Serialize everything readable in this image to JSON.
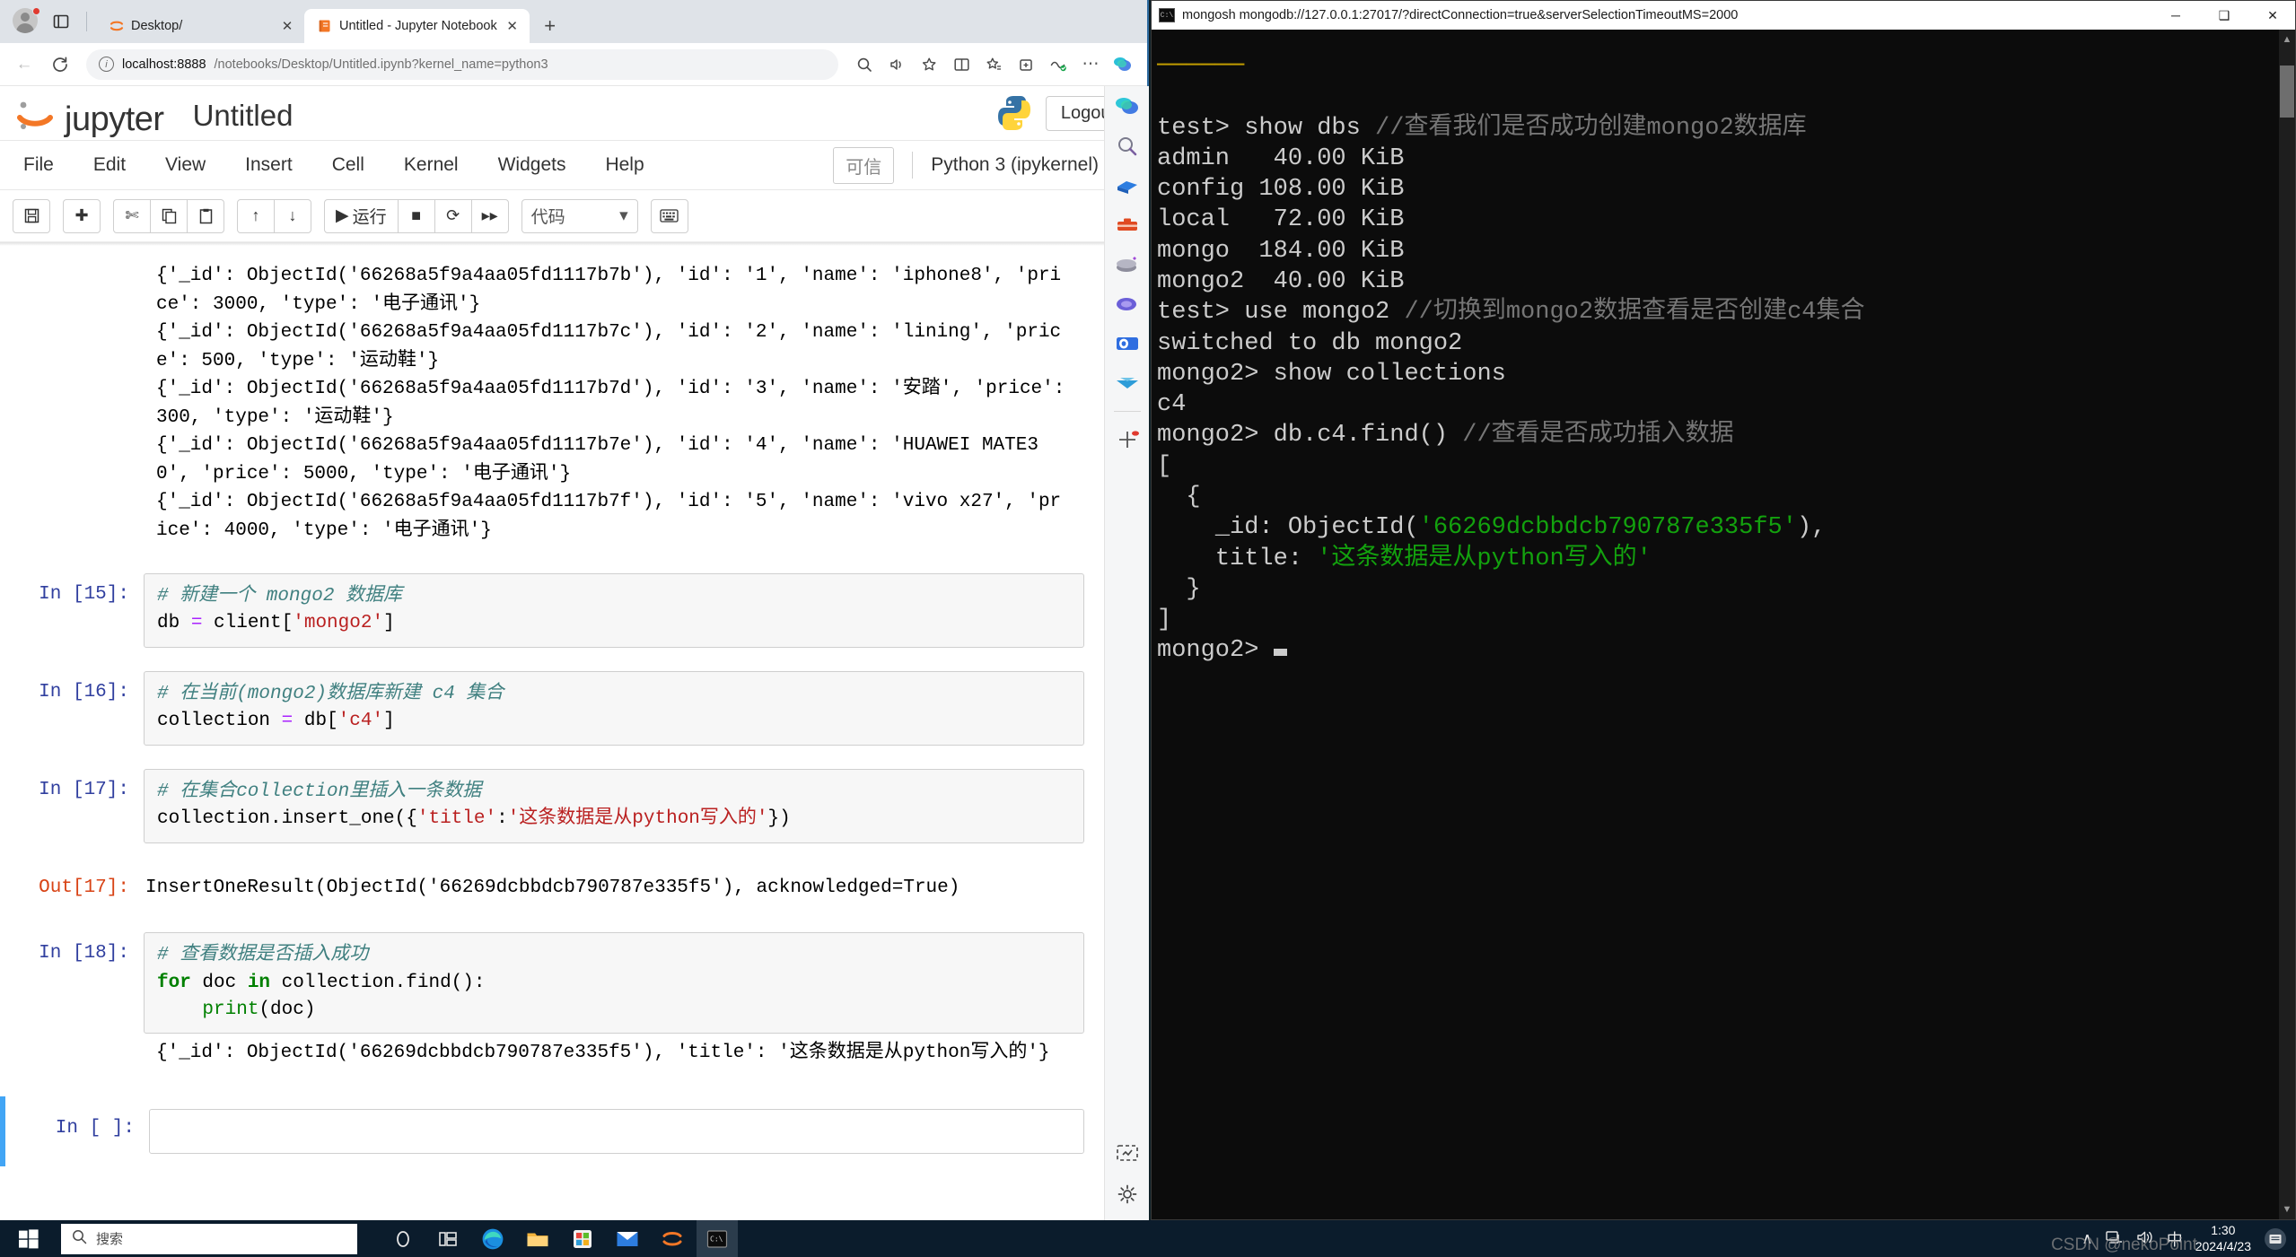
{
  "browser": {
    "tabs": [
      {
        "title": "Desktop/",
        "favicon": "jupyter-icon",
        "active": false
      },
      {
        "title": "Untitled - Jupyter Notebook",
        "favicon": "notebook-icon",
        "active": true
      }
    ],
    "newtab_label": "+",
    "address": {
      "host": "localhost:8888",
      "path": "/notebooks/Desktop/Untitled.ipynb?kernel_name=python3",
      "full": "localhost:8888/notebooks/Desktop/Untitled.ipynb?kernel_name=python3"
    },
    "nav": {
      "back": "←",
      "reload": "⟳"
    },
    "toolbar_icons": [
      "split-screen-icon",
      "favorites-icon",
      "collections-icon",
      "browser-essentials-icon",
      "settings-more-icon",
      "copilot-icon"
    ],
    "window_controls": {
      "minimize": "─",
      "maximize": "□",
      "close": "✕"
    }
  },
  "edge_sidebar": {
    "items": [
      "copilot-icon",
      "search-icon",
      "shopping-icon",
      "tools-icon",
      "games-icon",
      "office-icon",
      "outlook-icon",
      "drop-icon",
      "add-app-icon"
    ],
    "bottom": [
      "screenshot-icon",
      "sidebar-settings-icon"
    ]
  },
  "jupyter": {
    "logo_text": "jupyter",
    "notebook_title": "Untitled",
    "logout_label": "Logout",
    "trust_label": "可信",
    "kernel_label": "Python 3 (ipykernel)",
    "menus": [
      "File",
      "Edit",
      "View",
      "Insert",
      "Cell",
      "Kernel",
      "Widgets",
      "Help"
    ],
    "toolbar": {
      "save": "save-icon",
      "add": "add-cell-icon",
      "cut": "cut-icon",
      "copy": "copy-icon",
      "paste": "paste-icon",
      "move_up": "move-up-icon",
      "move_down": "move-down-icon",
      "run_label": "运行",
      "run_icon": "play-icon",
      "stop": "stop-icon",
      "restart": "restart-icon",
      "restart_run_all": "fast-forward-icon",
      "cell_type_value": "代码",
      "command_palette": "keyboard-icon"
    },
    "cells": [
      {
        "kind": "stream-output-top",
        "text": "{'_id': ObjectId('66268a5f9a4aa05fd1117b7b'), 'id': '1', 'name': 'iphone8', 'price': 3000, 'type': '电子通讯'}\n{'_id': ObjectId('66268a5f9a4aa05fd1117b7c'), 'id': '2', 'name': 'lining', 'price': 500, 'type': '运动鞋'}\n{'_id': ObjectId('66268a5f9a4aa05fd1117b7d'), 'id': '3', 'name': '安踏', 'price': 300, 'type': '运动鞋'}\n{'_id': ObjectId('66268a5f9a4aa05fd1117b7e'), 'id': '4', 'name': 'HUAWEI MATE30', 'price': 5000, 'type': '电子通讯'}\n{'_id': ObjectId('66268a5f9a4aa05fd1117b7f'), 'id': '5', 'name': 'vivo x27', 'price': 4000, 'type': '电子通讯'}"
      },
      {
        "kind": "code",
        "prompt": "In  [15]:",
        "comment": "# 新建一个 mongo2 数据库",
        "code_plain": "db = client['mongo2']"
      },
      {
        "kind": "code",
        "prompt": "In  [16]:",
        "comment": "# 在当前(mongo2)数据库新建 c4 集合",
        "code_plain": "collection = db['c4']"
      },
      {
        "kind": "code",
        "prompt": "In  [17]:",
        "comment": "# 在集合collection里插入一条数据",
        "code_plain": "collection.insert_one({'title':'这条数据是从python写入的'})"
      },
      {
        "kind": "result",
        "prompt": "Out[17]:",
        "text": "InsertOneResult(ObjectId('66269dcbbdcb790787e335f5'), acknowledged=True)"
      },
      {
        "kind": "code",
        "prompt": "In  [18]:",
        "comment": "# 查看数据是否插入成功",
        "code_plain": "for doc in collection.find():\n    print(doc)"
      },
      {
        "kind": "stream-output",
        "text": "{'_id': ObjectId('66269dcbbdcb790787e335f5'), 'title': '这条数据是从python写入的'}"
      },
      {
        "kind": "empty",
        "prompt": "In  [ ]:",
        "code_plain": ""
      }
    ]
  },
  "terminal": {
    "title": "mongosh mongodb://127.0.0.1:27017/?directConnection=true&serverSelectionTimeoutMS=2000",
    "window_controls": {
      "minimize": "─",
      "maximize": "❑",
      "close": "✕"
    },
    "lines": {
      "divider": "──────",
      "cmd1": "test> show dbs ",
      "cmd1_comment": "//查看我们是否成功创建mongo2数据库",
      "dbs": [
        {
          "name": "admin ",
          "size": "  40.00 KiB"
        },
        {
          "name": "config",
          "size": " 108.00 KiB"
        },
        {
          "name": "local ",
          "size": "  72.00 KiB"
        },
        {
          "name": "mongo ",
          "size": " 184.00 KiB"
        },
        {
          "name": "mongo2",
          "size": "  40.00 KiB"
        }
      ],
      "cmd2": "test> use mongo2 ",
      "cmd2_comment": "//切换到mongo2数据查看是否创建c4集合",
      "out2": "switched to db mongo2",
      "cmd3": "mongo2> show collections",
      "out3": "c4",
      "cmd4": "mongo2> db.c4.find() ",
      "cmd4_comment": "//查看是否成功插入数据",
      "json_open": "[",
      "json_brace_open": "  {",
      "json_id_key": "    _id: ObjectId(",
      "json_id_val": "'66269dcbbdcb790787e335f5'",
      "json_id_tail": "),",
      "json_title_key": "    title: ",
      "json_title_val": "'这条数据是从python写入的'",
      "json_brace_close": "  }",
      "json_close": "]",
      "prompt_last": "mongo2> "
    }
  },
  "taskbar": {
    "start": "windows-start-icon",
    "search_placeholder": "搜索",
    "apps": [
      "task-view-icon",
      "widgets-icon",
      "edge-icon",
      "file-explorer-icon",
      "microsoft-store-icon",
      "mail-icon",
      "jupyter-icon",
      "terminal-icon"
    ],
    "tray": {
      "chevron": "∧",
      "network": "network-icon",
      "volume": "volume-icon",
      "ime": "中",
      "time": "1:30",
      "date": "2024/4/23",
      "notifications": "notification-icon"
    },
    "watermark": "CSDN @nekoPoint"
  }
}
